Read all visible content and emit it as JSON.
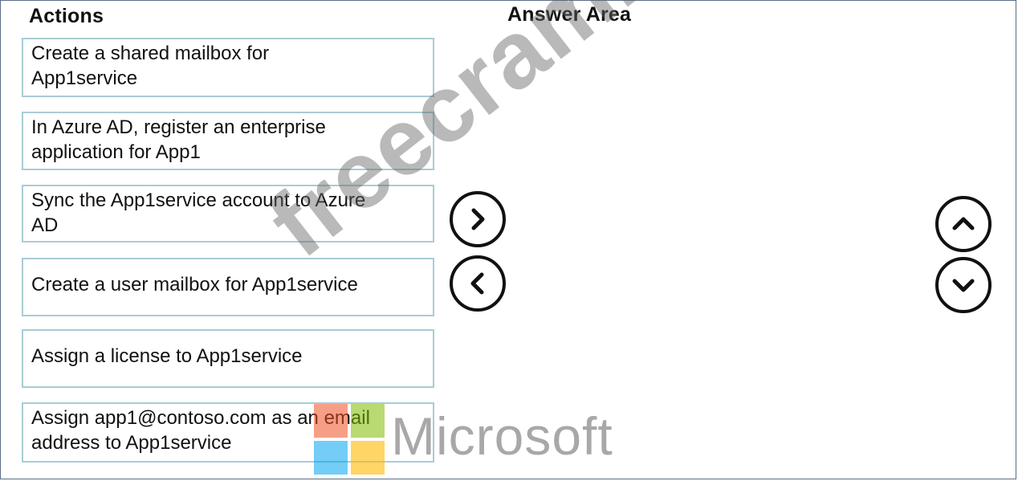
{
  "headings": {
    "actions": "Actions",
    "answer_area": "Answer Area"
  },
  "actions": [
    {
      "line1": "Create a shared mailbox for",
      "line2": "App1service"
    },
    {
      "line1": "In Azure AD, register an enterprise",
      "line2": "application for App1"
    },
    {
      "line1": "Sync the App1service account to Azure",
      "line2": "AD"
    },
    {
      "line1": "Create a user mailbox for App1service",
      "line2": ""
    },
    {
      "line1": "Assign a license to App1service",
      "line2": ""
    },
    {
      "line1": "Assign app1@contoso.com as an email",
      "line2": "address to App1service"
    }
  ],
  "controls": {
    "move_right_icon": "chevron-right-icon",
    "move_left_icon": "chevron-left-icon",
    "move_up_icon": "chevron-up-icon",
    "move_down_icon": "chevron-down-icon"
  },
  "watermark": {
    "site": "freecram.net",
    "brand": "Microsoft"
  },
  "colors": {
    "box_border": "#a8ccd6",
    "frame_border": "#5a6f86"
  }
}
